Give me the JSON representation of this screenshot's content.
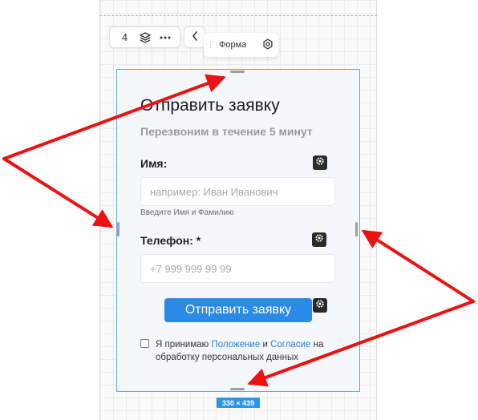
{
  "toolbar": {
    "layer_count": "4",
    "layers_icon": "layers-icon",
    "more_icon": "more-horizontal-icon",
    "back_icon": "chevron-left-icon"
  },
  "breadcrumb": {
    "label": "Форма",
    "icon": "settings-icon"
  },
  "form": {
    "title": "Отправить заявку",
    "subtitle": "Перезвоним в течение 5 минут",
    "name_label": "Имя:",
    "name_placeholder": "например: Иван Иванович",
    "name_hint": "Введите Имя и Фамилию",
    "phone_label": "Телефон: *",
    "phone_placeholder": "+7 999 999 99 99",
    "submit_label": "Отправить заявку",
    "consent": {
      "prefix": "Я принимаю",
      "link1": "Положение",
      "and": "и",
      "link2": "Согласие",
      "suffix": "на обработку персональных данных"
    }
  },
  "size_badge": "330 × 439",
  "colors": {
    "accent": "#2b8ae6",
    "selection_border": "#5fa8e6",
    "annotation_arrow": "#ee1111"
  }
}
